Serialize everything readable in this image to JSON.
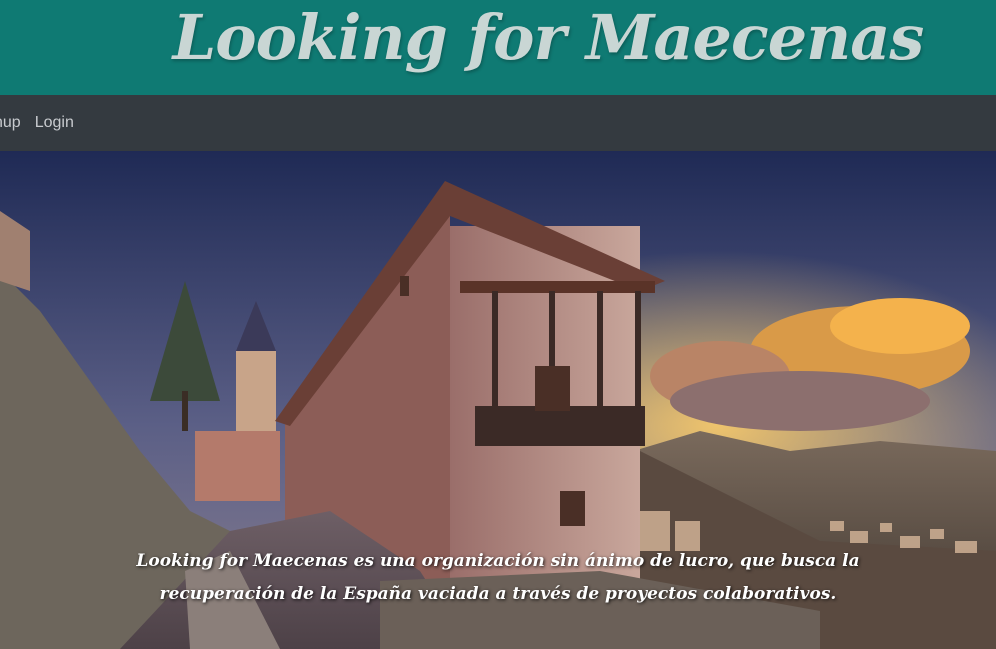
{
  "header": {
    "title": "Looking for Maecenas",
    "background_color": "#0f7a73",
    "title_color": "#c9d6d4"
  },
  "nav": {
    "items": [
      {
        "label": "nup"
      },
      {
        "label": "Login"
      }
    ],
    "background_color": "#343a40"
  },
  "hero": {
    "image_subject": "medieval house with wooden balcony, stone street, sunset clouds and hillside village",
    "caption": "Looking for Maecenas es una organización sin ánimo de lucro, que busca la recuperación de la España vaciada a través de proyectos colaborativos."
  }
}
